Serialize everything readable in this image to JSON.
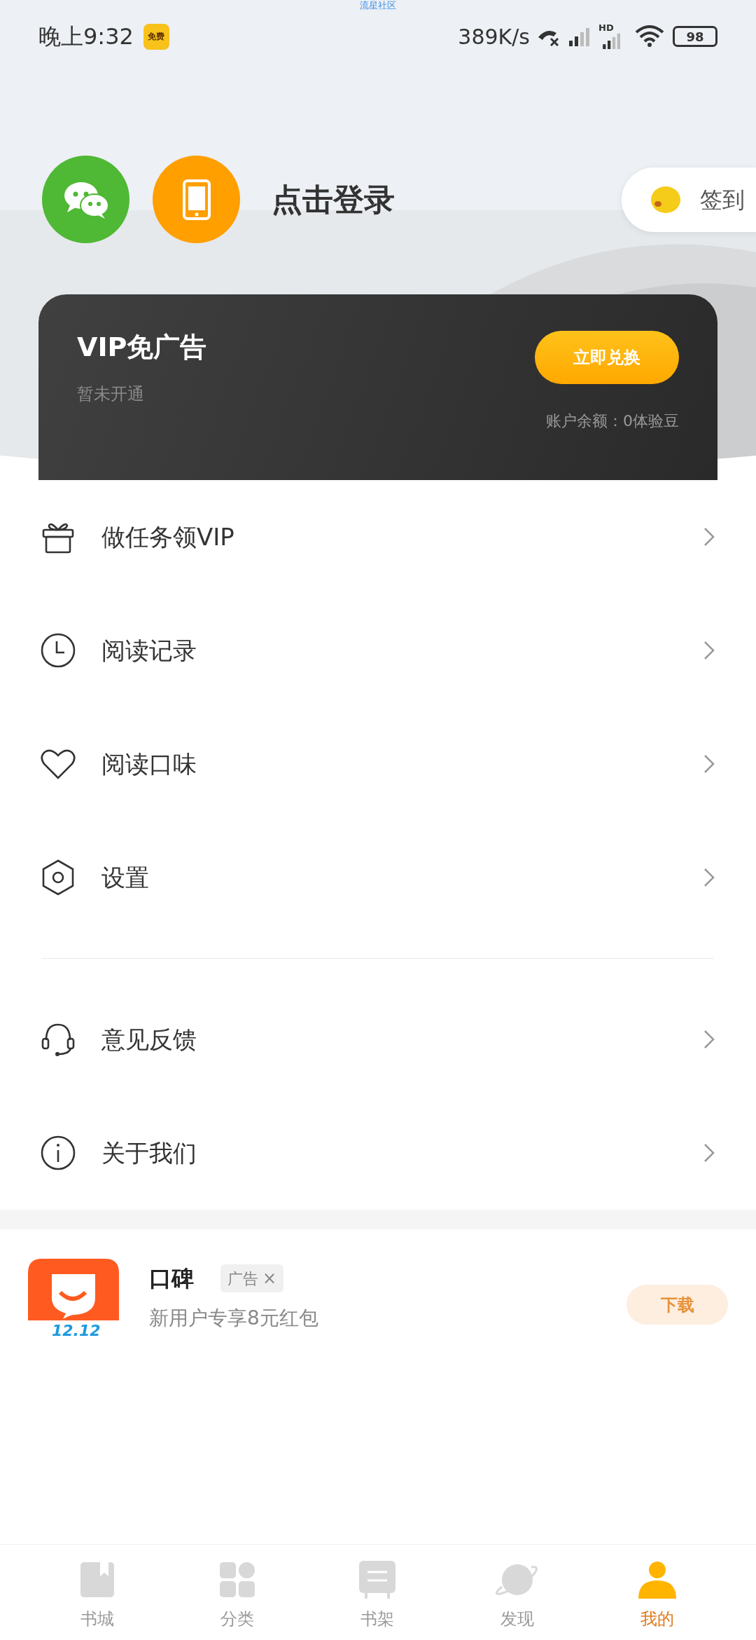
{
  "status_bar": {
    "carrier_label": "流星社区",
    "time": "晚上9:32",
    "app_badge": "免费",
    "speed": "389K/s",
    "network_label": "HD",
    "battery": "98"
  },
  "login": {
    "prompt": "点击登录",
    "checkin": "签到"
  },
  "vip_card": {
    "title": "VIP免广告",
    "status": "暂未开通",
    "button": "立即兑换",
    "balance": "账户余额：0体验豆"
  },
  "menu_groups": [
    {
      "items": [
        {
          "label": "做任务领VIP"
        },
        {
          "label": "阅读记录"
        },
        {
          "label": "阅读口味"
        },
        {
          "label": "设置"
        }
      ]
    },
    {
      "items": [
        {
          "label": "意见反馈"
        },
        {
          "label": "关于我们"
        }
      ]
    }
  ],
  "ad": {
    "app_name": "口碑",
    "tag": "广告",
    "close": "×",
    "description": "新用户专享8元红包",
    "icon_caption": "12.12",
    "button": "下载"
  },
  "bottom_nav": [
    {
      "label": "书城",
      "selected": false
    },
    {
      "label": "分类",
      "selected": false
    },
    {
      "label": "书架",
      "selected": false
    },
    {
      "label": "发现",
      "selected": false
    },
    {
      "label": "我的",
      "selected": true
    }
  ]
}
